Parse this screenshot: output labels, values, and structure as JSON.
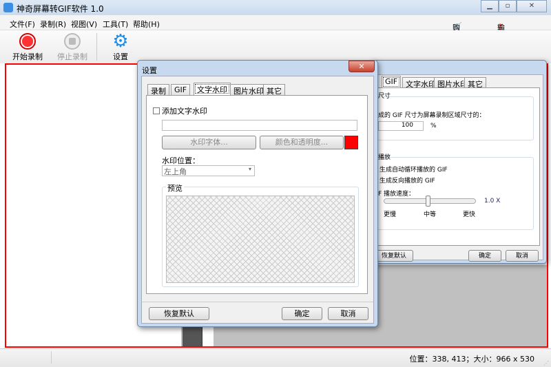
{
  "app": {
    "title": "神奇屏幕转GIF软件 1.0",
    "buy": "购买软件",
    "license": "输入授权码"
  },
  "menu": [
    "文件(F)",
    "录制(R)",
    "视图(V)",
    "工具(T)",
    "帮助(H)"
  ],
  "toolbar": {
    "start": "开始录制",
    "stop": "停止录制",
    "settings": "设置"
  },
  "status": {
    "text": "位置：338, 413；大小：966 x 530"
  },
  "bg_dialog": {
    "tabs": [
      "GIF",
      "文字水印",
      "图片水印",
      "其它"
    ],
    "size_group": "尺寸",
    "size_desc": "成的 GIF 尺寸为屏幕录制区域尺寸的：",
    "size_value": "100",
    "size_unit": "%",
    "play_group": "播放",
    "loop": "生成自动循环播放的 GIF",
    "reverse": "生成反向播放的 GIF",
    "speed_label": "F 播放速度：",
    "speed_value": "1.0 X",
    "speed_level": 0.5,
    "slow": "更慢",
    "medium": "中等",
    "fast": "更快",
    "restore": "恢复默认",
    "ok": "确定",
    "cancel": "取消"
  },
  "dialog": {
    "title": "设置",
    "tabs": [
      "录制",
      "GIF",
      "文字水印",
      "图片水印",
      "其它"
    ],
    "active_tab": "文字水印",
    "add_watermark": "添加文字水印",
    "add_watermark_checked": false,
    "watermark_text": "",
    "font_btn": "水印字体...",
    "color_btn": "颜色和透明度...",
    "color": "#ff0000",
    "position_label": "水印位置：",
    "position_value": "左上角",
    "preview_label": "预览",
    "restore": "恢复默认",
    "ok": "确定",
    "cancel": "取消"
  }
}
